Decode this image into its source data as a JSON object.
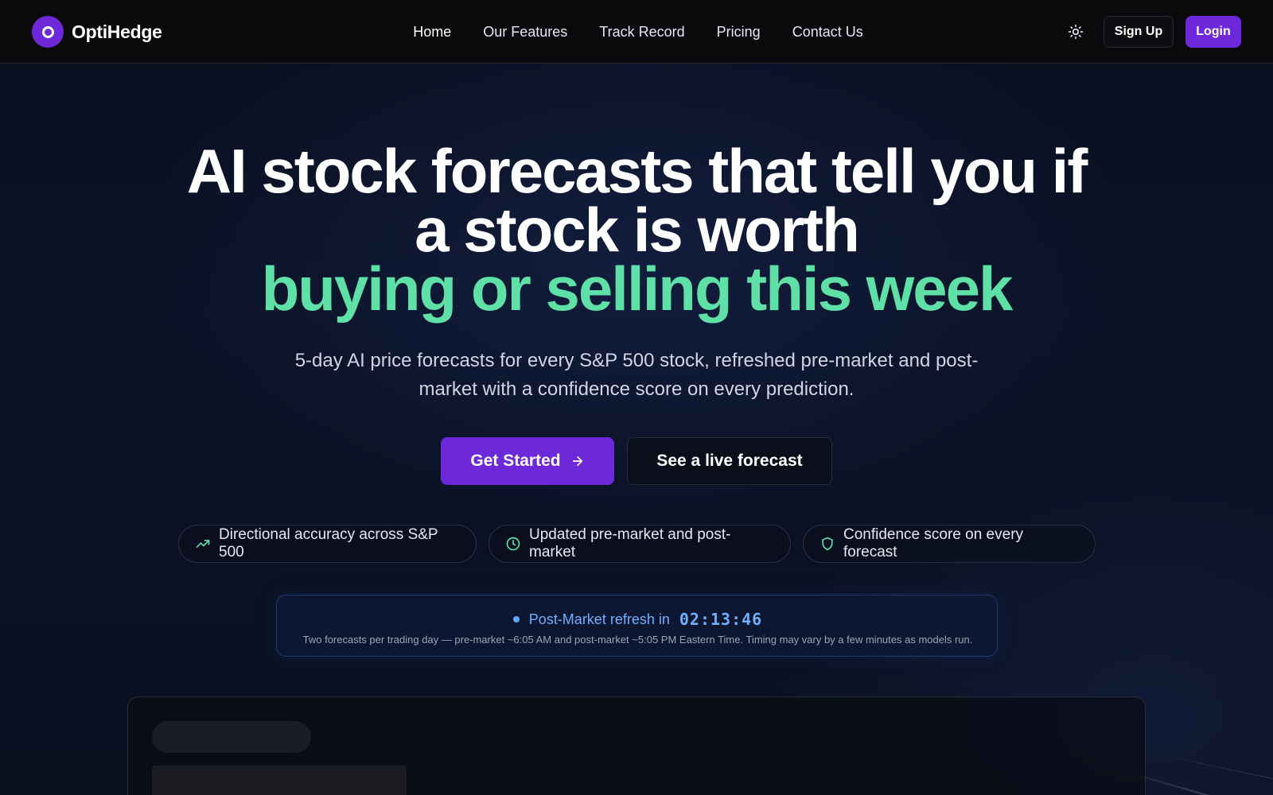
{
  "brand": {
    "name": "OptiHedge"
  },
  "nav": {
    "links": [
      "Home",
      "Our Features",
      "Track Record",
      "Pricing",
      "Contact Us"
    ],
    "active": "Home",
    "signup_label": "Sign Up",
    "login_label": "Login"
  },
  "hero": {
    "title_line1": "AI stock forecasts that tell you if",
    "title_line2": "a stock is worth",
    "title_accent": "buying or selling this week",
    "subtitle": "5-day AI price forecasts for every S&P 500 stock, refreshed pre-market and post-market with a confidence score on every prediction.",
    "cta_primary": "Get Started",
    "cta_secondary": "See a live forecast"
  },
  "pills": [
    {
      "icon": "trending-up-icon",
      "label": "Directional accuracy across S&P 500"
    },
    {
      "icon": "clock-icon",
      "label": "Updated pre-market and post-market"
    },
    {
      "icon": "shield-icon",
      "label": "Confidence score on every forecast"
    }
  ],
  "refresh": {
    "label": "Post-Market refresh in",
    "countdown": "02:13:46",
    "note": "Two forecasts per trading day — pre-market ~6:05 AM and post-market ~5:05 PM Eastern Time. Timing may vary by a few minutes as models run."
  },
  "colors": {
    "accent_purple": "#6d28d9",
    "accent_green": "#5ee0a6",
    "accent_blue": "#6fb0ff",
    "background": "#0b1020"
  }
}
